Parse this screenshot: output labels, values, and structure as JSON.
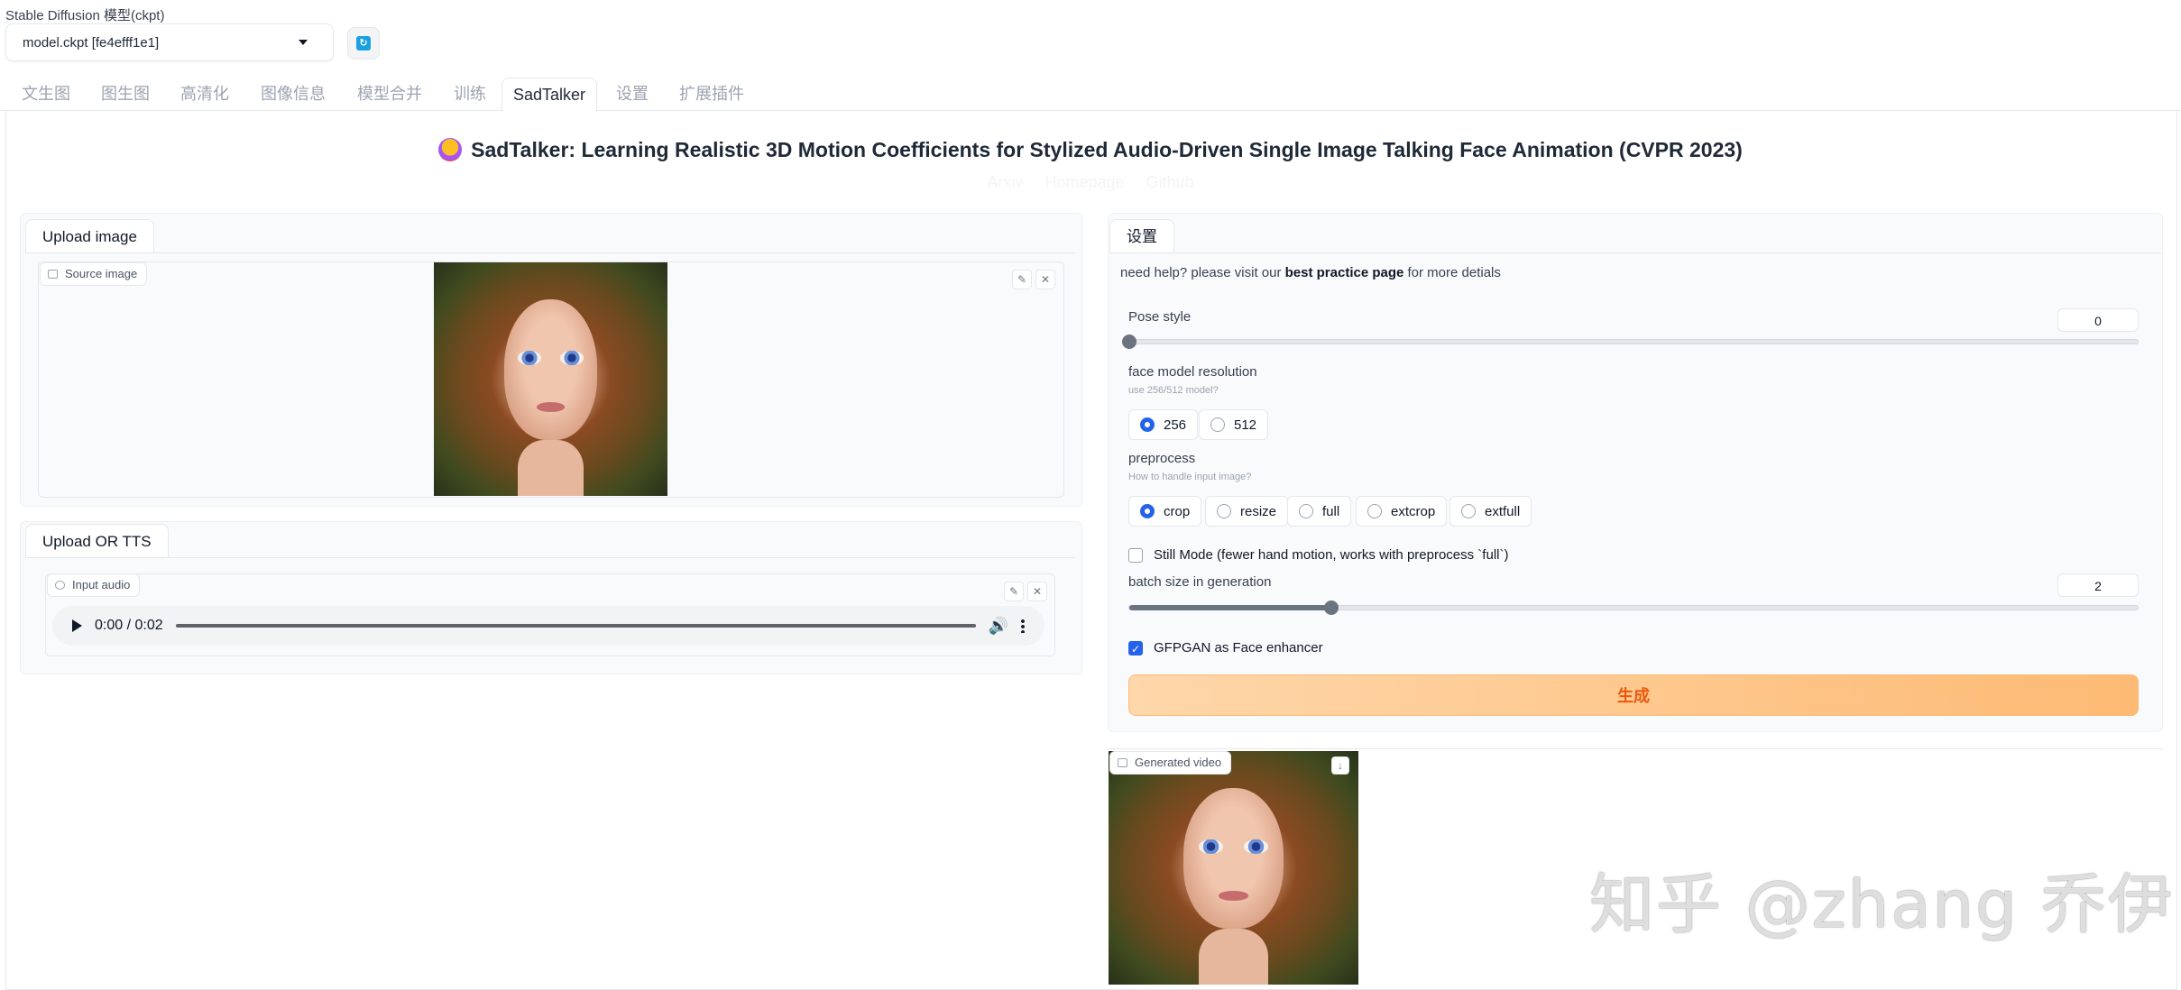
{
  "header": {
    "ckpt_label": "Stable Diffusion 模型(ckpt)",
    "ckpt_value": "model.ckpt [fe4efff1e1]"
  },
  "tabs": [
    "文生图",
    "图生图",
    "高清化",
    "图像信息",
    "模型合并",
    "训练",
    "SadTalker",
    "设置",
    "扩展插件"
  ],
  "title": "SadTalker: Learning Realistic 3D Motion Coefficients for Stylized Audio-Driven Single Image Talking Face Animation (CVPR 2023)",
  "links": [
    "Arxiv",
    "Homepage",
    "Github"
  ],
  "left": {
    "upload_tab": "Upload image",
    "source_image_label": "Source image",
    "tts_tab": "Upload OR TTS",
    "input_audio_label": "Input audio",
    "audio_time": "0:00 / 0:02"
  },
  "settings": {
    "tab": "设置",
    "help_prefix": "need help? please visit our ",
    "help_link": "best practice page",
    "help_suffix": " for more detials",
    "pose_style_label": "Pose style",
    "pose_style_value": "0",
    "pose_style_fraction": 0.0,
    "resolution_label": "face model resolution",
    "resolution_hint": "use 256/512 model?",
    "resolution_options": [
      "256",
      "512"
    ],
    "resolution_selected": "256",
    "preprocess_label": "preprocess",
    "preprocess_hint": "How to handle input image?",
    "preprocess_options": [
      "crop",
      "resize",
      "full",
      "extcrop",
      "extfull"
    ],
    "preprocess_selected": "crop",
    "still_mode_label": "Still Mode (fewer hand motion, works with preprocess `full`)",
    "still_mode_checked": false,
    "batch_label": "batch size in generation",
    "batch_value": "2",
    "batch_fraction": 0.2,
    "gfpgan_label": "GFPGAN as Face enhancer",
    "gfpgan_checked": true,
    "generate_label": "生成"
  },
  "output": {
    "video_label": "Generated video"
  },
  "watermark": "知乎 @zhang 乔伊"
}
